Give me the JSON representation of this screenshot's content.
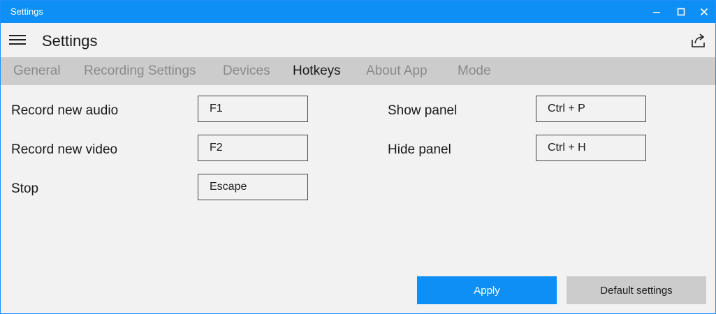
{
  "window": {
    "title": "Settings"
  },
  "header": {
    "title": "Settings",
    "menu_icon": "hamburger-icon",
    "share_icon": "share-icon"
  },
  "tabs": [
    {
      "label": "General",
      "active": false
    },
    {
      "label": "Recording Settings",
      "active": false
    },
    {
      "label": "Devices",
      "active": false
    },
    {
      "label": "Hotkeys",
      "active": true
    },
    {
      "label": "About App",
      "active": false
    },
    {
      "label": "Mode",
      "active": false
    }
  ],
  "hotkeys": {
    "record_audio": {
      "label": "Record new audio",
      "value": "F1"
    },
    "record_video": {
      "label": "Record new video",
      "value": "F2"
    },
    "stop": {
      "label": "Stop",
      "value": "Escape"
    },
    "show_panel": {
      "label": "Show panel",
      "value": "Ctrl + P"
    },
    "hide_panel": {
      "label": "Hide panel",
      "value": "Ctrl + H"
    }
  },
  "buttons": {
    "apply": "Apply",
    "default": "Default settings"
  },
  "colors": {
    "accent": "#0e8ff5",
    "tab_bar": "#cccccc",
    "background": "#f2f2f2"
  }
}
